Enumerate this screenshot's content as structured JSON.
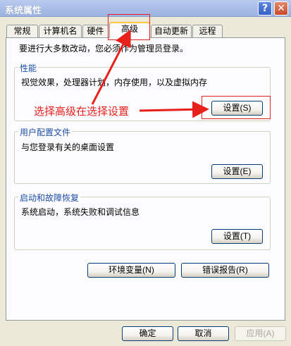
{
  "window": {
    "title": "系统属性",
    "help_glyph": "?",
    "close_glyph": "✕"
  },
  "tabs": [
    {
      "label": "常规"
    },
    {
      "label": "计算机名"
    },
    {
      "label": "硬件"
    },
    {
      "label": "高级"
    },
    {
      "label": "自动更新"
    },
    {
      "label": "远程"
    }
  ],
  "admin_notice": "要进行大多数改动，您必须作为管理员登录。",
  "performance": {
    "title": "性能",
    "description": "视觉效果，处理器计划，内存使用，以及虚拟内存",
    "button": "设置(S)"
  },
  "user_profiles": {
    "title": "用户配置文件",
    "description": "与您登录有关的桌面设置",
    "button": "设置(E)"
  },
  "startup_recovery": {
    "title": "启动和故障恢复",
    "description": "系统启动，系统失败和调试信息",
    "button": "设置(T)"
  },
  "env_button": "环境变量(N)",
  "error_button": "错误报告(R)",
  "footer": {
    "ok": "确定",
    "cancel": "取消",
    "apply": "应用(A)"
  },
  "annotation": {
    "text": "选择高级在选择设置",
    "color": "#e8201c"
  }
}
